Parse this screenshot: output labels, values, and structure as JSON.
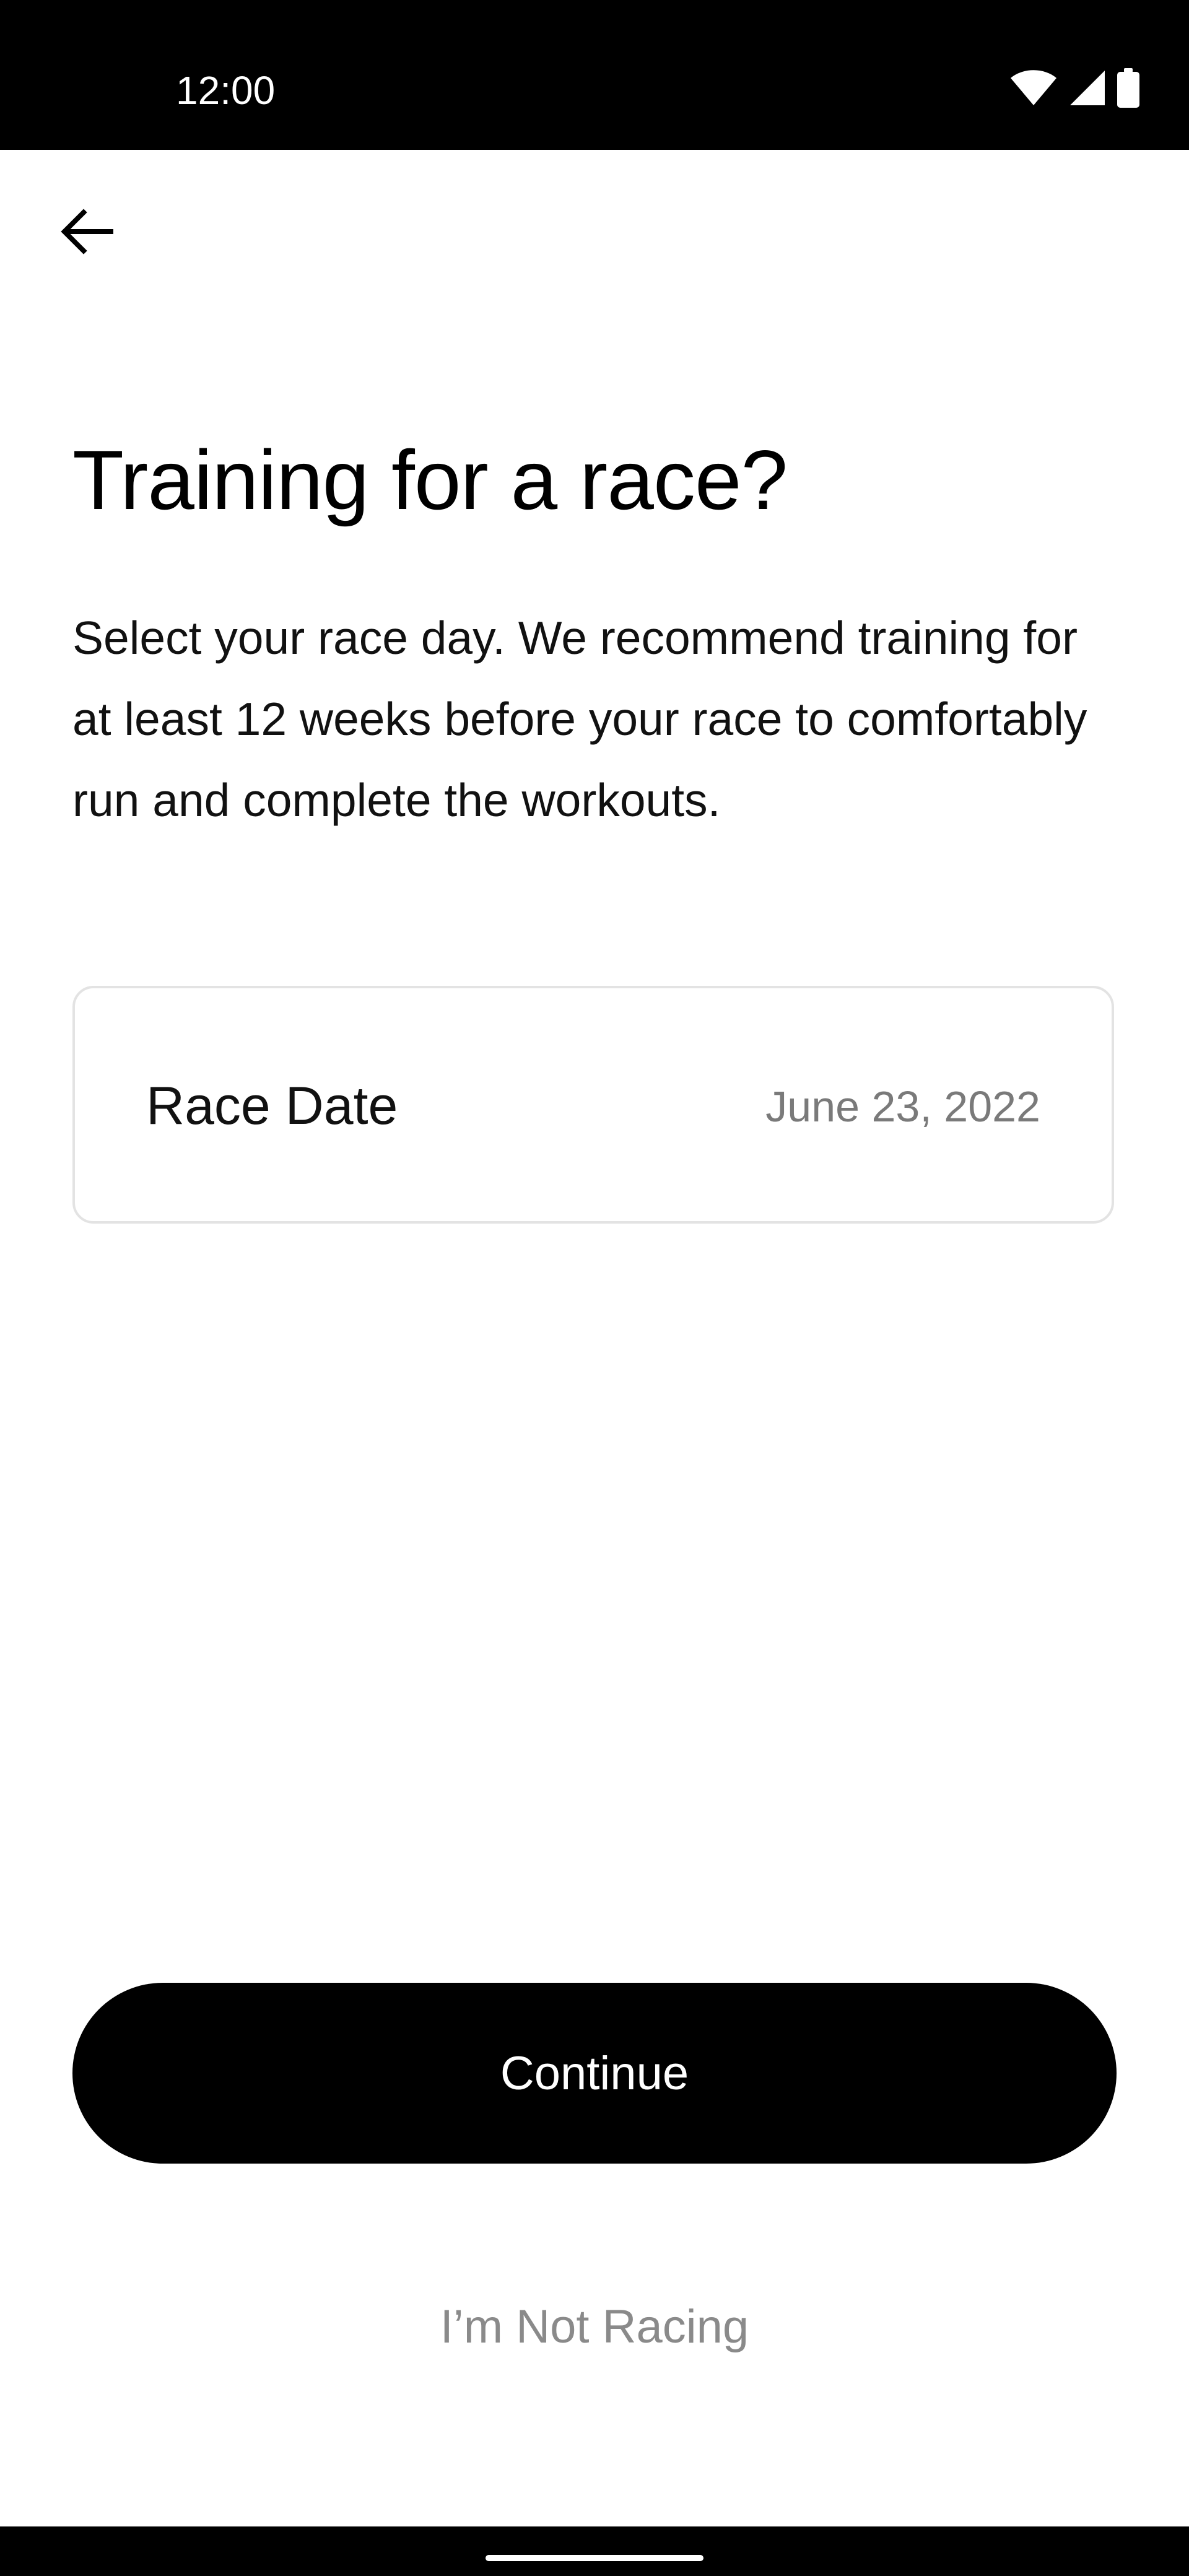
{
  "status_bar": {
    "time": "12:00",
    "icons": [
      "wifi-icon",
      "cellular-signal-icon",
      "battery-icon"
    ]
  },
  "header": {
    "back_icon": "arrow-left-icon"
  },
  "main": {
    "title": "Training for a race?",
    "description": "Select your race day. We recommend training for at least 12 weeks before your race to comfortably run and complete the workouts.",
    "race_date": {
      "label": "Race Date",
      "value": "June 23, 2022"
    }
  },
  "actions": {
    "continue_label": "Continue",
    "not_racing_label": "I’m Not Racing"
  },
  "colors": {
    "primary": "#000000",
    "background": "#ffffff",
    "muted_text": "#8a8a8a",
    "card_border": "#e3e3e3"
  }
}
